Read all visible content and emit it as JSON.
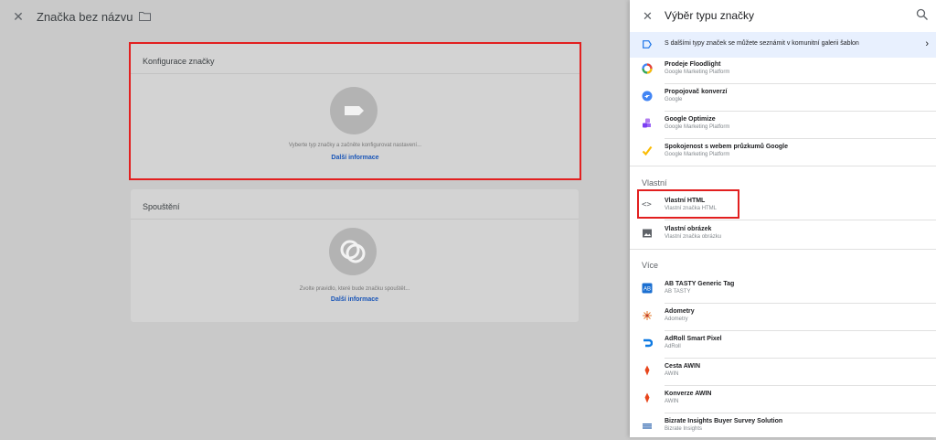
{
  "editor": {
    "title": "Značka bez názvu",
    "config_card": {
      "title": "Konfigurace značky",
      "hint": "Vyberte typ značky a začněte konfigurovat nastavení...",
      "link": "Další informace"
    },
    "trigger_card": {
      "title": "Spouštění",
      "hint": "Zvolte pravidlo, které bude značku spouštět...",
      "link": "Další informace"
    }
  },
  "panel": {
    "title": "Výběr typu značky",
    "banner": "S dalšími typy značek se můžete seznámit v komunitní galerii šablon",
    "top_items": [
      {
        "name": "Prodeje Floodlight",
        "sub": "Google Marketing Platform",
        "icon": "floodlight-icon"
      },
      {
        "name": "Propojovač konverzí",
        "sub": "Google",
        "icon": "conversion-linker-icon"
      },
      {
        "name": "Google Optimize",
        "sub": "Google Marketing Platform",
        "icon": "optimize-icon"
      },
      {
        "name": "Spokojenost s webem průzkumů Google",
        "sub": "Google Marketing Platform",
        "icon": "surveys-icon"
      }
    ],
    "section_custom": "Vlastní",
    "custom_items": [
      {
        "name": "Vlastní HTML",
        "sub": "Vlastní značka HTML",
        "icon": "code-icon"
      },
      {
        "name": "Vlastní obrázek",
        "sub": "Vlastní značka obrázku",
        "icon": "image-icon"
      }
    ],
    "section_more": "Více",
    "more_items": [
      {
        "name": "AB TASTY Generic Tag",
        "sub": "AB TASTY",
        "icon": "abtasty-icon"
      },
      {
        "name": "Adometry",
        "sub": "Adometry",
        "icon": "adometry-icon"
      },
      {
        "name": "AdRoll Smart Pixel",
        "sub": "AdRoll",
        "icon": "adroll-icon"
      },
      {
        "name": "Cesta AWIN",
        "sub": "AWIN",
        "icon": "awin-icon"
      },
      {
        "name": "Konverze AWIN",
        "sub": "AWIN",
        "icon": "awin-icon"
      },
      {
        "name": "Bizrate Insights Buyer Survey Solution",
        "sub": "Bizrate Insights",
        "icon": "bizrate-icon"
      }
    ]
  },
  "colors": {
    "highlight": "#e21f1f",
    "link": "#1a56b8",
    "banner_bg": "#e8f0fe"
  }
}
